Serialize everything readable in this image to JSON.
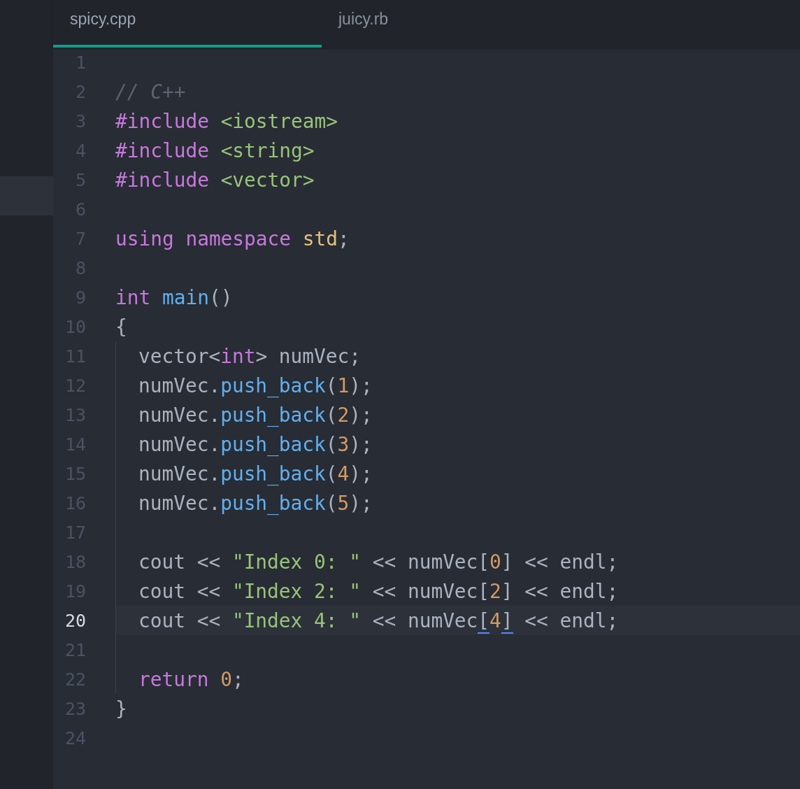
{
  "tabs": [
    {
      "label": "spicy.cpp",
      "selected": true
    },
    {
      "label": "juicy.rb",
      "selected": false
    }
  ],
  "lines": [
    {
      "number": "1",
      "current": false,
      "indented": false
    },
    {
      "number": "2",
      "current": false,
      "indented": false,
      "tokens": [
        {
          "text": "// C++",
          "kind": "comment"
        }
      ]
    },
    {
      "number": "3",
      "current": false,
      "indented": false,
      "tokens": [
        {
          "text": "#include ",
          "kind": "keyword"
        },
        {
          "text": "<iostream>",
          "kind": "string"
        }
      ]
    },
    {
      "number": "4",
      "current": false,
      "indented": false,
      "tokens": [
        {
          "text": "#include ",
          "kind": "keyword"
        },
        {
          "text": "<string>",
          "kind": "string"
        }
      ]
    },
    {
      "number": "5",
      "current": false,
      "indented": false,
      "tokens": [
        {
          "text": "#include ",
          "kind": "keyword"
        },
        {
          "text": "<vector>",
          "kind": "string"
        }
      ]
    },
    {
      "number": "6",
      "current": false,
      "indented": false
    },
    {
      "number": "7",
      "current": false,
      "indented": false,
      "tokens": [
        {
          "text": "using namespace ",
          "kind": "keyword"
        },
        {
          "text": "std",
          "kind": "type"
        },
        {
          "text": ";",
          "kind": "plain"
        }
      ]
    },
    {
      "number": "8",
      "current": false,
      "indented": false
    },
    {
      "number": "9",
      "current": false,
      "indented": false,
      "tokens": [
        {
          "text": "int ",
          "kind": "keyword"
        },
        {
          "text": "main",
          "kind": "function"
        },
        {
          "text": "()",
          "kind": "plain"
        }
      ]
    },
    {
      "number": "10",
      "current": false,
      "indented": false,
      "tokens": [
        {
          "text": "{",
          "kind": "plain"
        }
      ]
    },
    {
      "number": "11",
      "current": false,
      "indented": true,
      "tokens": [
        {
          "text": "vector<",
          "kind": "plain"
        },
        {
          "text": "int",
          "kind": "keyword"
        },
        {
          "text": "> numVec;",
          "kind": "plain"
        }
      ]
    },
    {
      "number": "12",
      "current": false,
      "indented": true,
      "tokens": [
        {
          "text": "numVec.",
          "kind": "plain"
        },
        {
          "text": "push_back",
          "kind": "function"
        },
        {
          "text": "(",
          "kind": "plain"
        },
        {
          "text": "1",
          "kind": "number"
        },
        {
          "text": ");",
          "kind": "plain"
        }
      ]
    },
    {
      "number": "13",
      "current": false,
      "indented": true,
      "tokens": [
        {
          "text": "numVec.",
          "kind": "plain"
        },
        {
          "text": "push_back",
          "kind": "function"
        },
        {
          "text": "(",
          "kind": "plain"
        },
        {
          "text": "2",
          "kind": "number"
        },
        {
          "text": ");",
          "kind": "plain"
        }
      ]
    },
    {
      "number": "14",
      "current": false,
      "indented": true,
      "tokens": [
        {
          "text": "numVec.",
          "kind": "plain"
        },
        {
          "text": "push_back",
          "kind": "function"
        },
        {
          "text": "(",
          "kind": "plain"
        },
        {
          "text": "3",
          "kind": "number"
        },
        {
          "text": ");",
          "kind": "plain"
        }
      ]
    },
    {
      "number": "15",
      "current": false,
      "indented": true,
      "tokens": [
        {
          "text": "numVec.",
          "kind": "plain"
        },
        {
          "text": "push_back",
          "kind": "function"
        },
        {
          "text": "(",
          "kind": "plain"
        },
        {
          "text": "4",
          "kind": "number"
        },
        {
          "text": ");",
          "kind": "plain"
        }
      ]
    },
    {
      "number": "16",
      "current": false,
      "indented": true,
      "tokens": [
        {
          "text": "numVec.",
          "kind": "plain"
        },
        {
          "text": "push_back",
          "kind": "function"
        },
        {
          "text": "(",
          "kind": "plain"
        },
        {
          "text": "5",
          "kind": "number"
        },
        {
          "text": ");",
          "kind": "plain"
        }
      ]
    },
    {
      "number": "17",
      "current": false,
      "indented": true
    },
    {
      "number": "18",
      "current": false,
      "indented": true,
      "tokens": [
        {
          "text": "cout << ",
          "kind": "plain"
        },
        {
          "text": "\"Index 0: \"",
          "kind": "string"
        },
        {
          "text": " << numVec[",
          "kind": "plain"
        },
        {
          "text": "0",
          "kind": "number"
        },
        {
          "text": "] << endl;",
          "kind": "plain"
        }
      ]
    },
    {
      "number": "19",
      "current": false,
      "indented": true,
      "tokens": [
        {
          "text": "cout << ",
          "kind": "plain"
        },
        {
          "text": "\"Index 2: \"",
          "kind": "string"
        },
        {
          "text": " << numVec[",
          "kind": "plain"
        },
        {
          "text": "2",
          "kind": "number"
        },
        {
          "text": "] << endl;",
          "kind": "plain"
        }
      ]
    },
    {
      "number": "20",
      "current": true,
      "indented": true,
      "tokens": [
        {
          "text": "cout << ",
          "kind": "plain"
        },
        {
          "text": "\"Index 4: \"",
          "kind": "string"
        },
        {
          "text": " << numVec",
          "kind": "plain"
        },
        {
          "text": "[",
          "kind": "match"
        },
        {
          "text": "4",
          "kind": "number"
        },
        {
          "text": "]",
          "kind": "match"
        },
        {
          "text": " << endl;",
          "kind": "plain"
        }
      ]
    },
    {
      "number": "21",
      "current": false,
      "indented": true
    },
    {
      "number": "22",
      "current": false,
      "indented": true,
      "tokens": [
        {
          "text": "return ",
          "kind": "keyword"
        },
        {
          "text": "0",
          "kind": "number"
        },
        {
          "text": ";",
          "kind": "plain"
        }
      ]
    },
    {
      "number": "23",
      "current": false,
      "indented": false,
      "tokens": [
        {
          "text": "}",
          "kind": "plain"
        }
      ]
    },
    {
      "number": "24",
      "current": false,
      "indented": false
    }
  ]
}
